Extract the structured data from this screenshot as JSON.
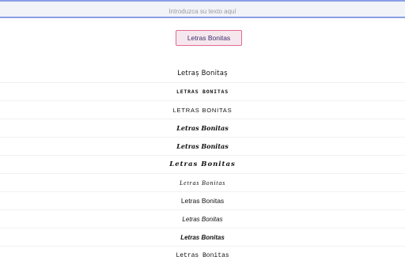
{
  "input": {
    "placeholder": "Introduzca su texto aquí",
    "value": ""
  },
  "button": {
    "label": "Letras Bonitas"
  },
  "variants": [
    "Letraș Bonitaș",
    "LETRAS BONITAS",
    "LETRAS BONITAS",
    "Letras Bonitas",
    "Letras Bonitas",
    "Letras Bonitas",
    "Letras Bonitas",
    "Letras Bonitas",
    "Letras Bonitas",
    "Letras Bonitas",
    "Letras Bonitas"
  ],
  "colors": {
    "input_border": "#8a9fe6",
    "input_bg": "#f1f3f9",
    "button_border": "#e46a8f",
    "button_bg": "#f6e7ee",
    "button_text": "#3d2b6b"
  }
}
